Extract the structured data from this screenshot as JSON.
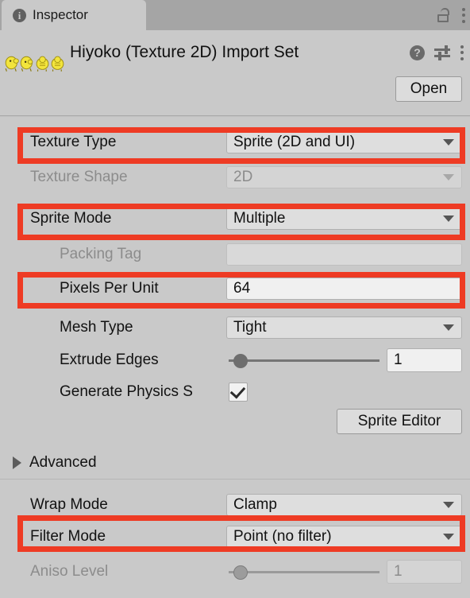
{
  "window": {
    "tab_label": "Inspector",
    "tab_icon": "info-icon",
    "lock_icon": "unlocked-padlock-icon",
    "menu_icon": "kebab-menu-icon"
  },
  "header": {
    "title": "Hiyoko (Texture 2D) Import Set",
    "help_icon": "help-icon",
    "presets_icon": "preset-sliders-icon",
    "menu_icon": "kebab-menu-icon",
    "open_button": "Open",
    "preview_alt": "hiyoko-chick-spritesheet"
  },
  "properties": [
    {
      "label": "Texture Type",
      "value": "Sprite (2D and UI)",
      "control": "dropdown",
      "enabled": true,
      "highlighted": true,
      "indent": "root"
    },
    {
      "label": "Texture Shape",
      "value": "2D",
      "control": "dropdown",
      "enabled": false,
      "highlighted": false,
      "indent": "root"
    },
    {
      "label": "Sprite Mode",
      "value": "Multiple",
      "control": "dropdown",
      "enabled": true,
      "highlighted": true,
      "indent": "root"
    },
    {
      "label": "Packing Tag",
      "value": "",
      "control": "text",
      "enabled": false,
      "highlighted": false,
      "indent": "indent"
    },
    {
      "label": "Pixels Per Unit",
      "value": "64",
      "control": "text",
      "enabled": true,
      "highlighted": true,
      "indent": "indent"
    },
    {
      "label": "Mesh Type",
      "value": "Tight",
      "control": "dropdown",
      "enabled": true,
      "highlighted": false,
      "indent": "indent"
    },
    {
      "label": "Extrude Edges",
      "value": "1",
      "control": "slider",
      "enabled": true,
      "highlighted": false,
      "indent": "indent",
      "slider_pct": 4
    },
    {
      "label": "Generate Physics S",
      "value": "checked",
      "control": "checkbox",
      "enabled": true,
      "highlighted": false,
      "indent": "indent"
    }
  ],
  "sprite_editor_button": "Sprite Editor",
  "advanced": {
    "label": "Advanced",
    "expanded": false,
    "arrow_icon": "triangle-right-icon"
  },
  "advanced_properties": [
    {
      "label": "Wrap Mode",
      "value": "Clamp",
      "control": "dropdown",
      "enabled": true,
      "highlighted": false,
      "indent": "root"
    },
    {
      "label": "Filter Mode",
      "value": "Point (no filter)",
      "control": "dropdown",
      "enabled": true,
      "highlighted": true,
      "indent": "root"
    },
    {
      "label": "Aniso Level",
      "value": "1",
      "control": "slider",
      "enabled": false,
      "highlighted": false,
      "indent": "root",
      "slider_pct": 4
    }
  ],
  "colors": {
    "highlight": "#ee3b24",
    "panel_bg": "#c9c9c9",
    "tabbar_bg": "#a5a5a5",
    "field_bg": "#dedede",
    "chick_yellow": "#f2e43c"
  }
}
